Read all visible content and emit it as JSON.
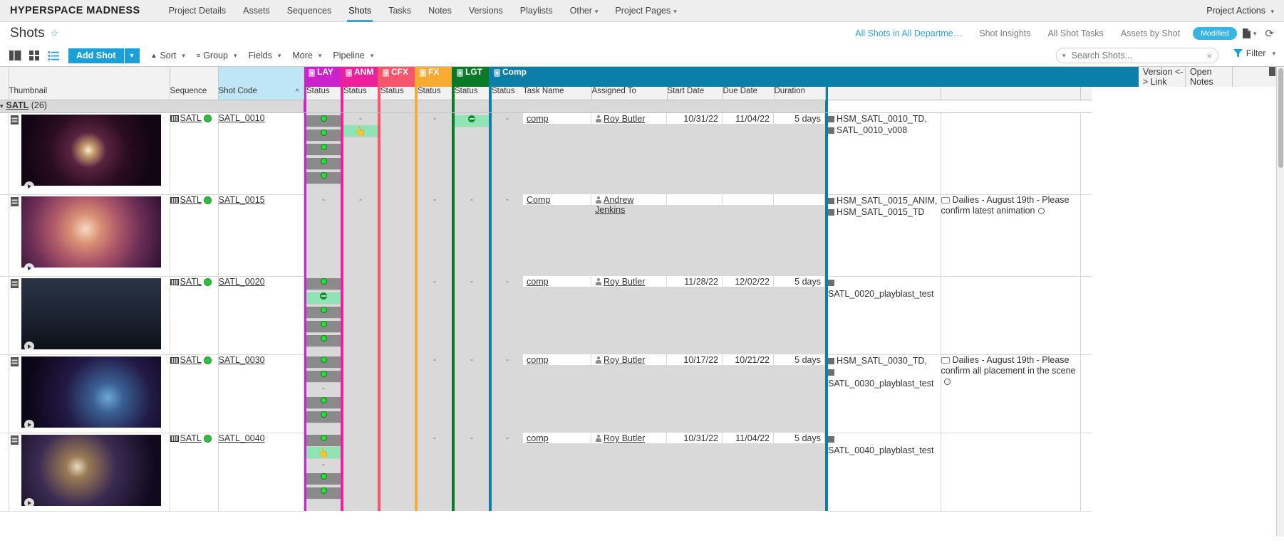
{
  "topnav": {
    "brand": "HYPERSPACE MADNESS",
    "items": [
      {
        "label": "Project Details",
        "active": false,
        "caret": false
      },
      {
        "label": "Assets",
        "active": false,
        "caret": false
      },
      {
        "label": "Sequences",
        "active": false,
        "caret": false
      },
      {
        "label": "Shots",
        "active": true,
        "caret": false
      },
      {
        "label": "Tasks",
        "active": false,
        "caret": false
      },
      {
        "label": "Notes",
        "active": false,
        "caret": false
      },
      {
        "label": "Versions",
        "active": false,
        "caret": false
      },
      {
        "label": "Playlists",
        "active": false,
        "caret": false
      },
      {
        "label": "Other",
        "active": false,
        "caret": true
      },
      {
        "label": "Project Pages",
        "active": false,
        "caret": true
      }
    ],
    "project_actions": "Project Actions"
  },
  "title": {
    "text": "Shots",
    "star": "☆",
    "links": [
      {
        "label": "All Shots in All Departme…",
        "blue": true
      },
      {
        "label": "Shot Insights",
        "blue": false
      },
      {
        "label": "All Shot Tasks",
        "blue": false
      },
      {
        "label": "Assets by Shot",
        "blue": false
      }
    ],
    "badge": "Modified"
  },
  "toolbar": {
    "add_shot": "Add Shot",
    "items": [
      {
        "label": "Sort",
        "icon": "sort-icon"
      },
      {
        "label": "Group",
        "icon": "group-icon"
      },
      {
        "label": "Fields",
        "icon": "fields-icon"
      },
      {
        "label": "More",
        "icon": "more-icon"
      },
      {
        "label": "Pipeline",
        "icon": "pipeline-icon"
      }
    ],
    "filter": "Filter"
  },
  "search": {
    "placeholder": "Search Shots...",
    "value": ""
  },
  "colors": {
    "lay": "#cc22cc",
    "anm": "#ee1f9a",
    "cfx": "#f8546b",
    "fx": "#f7ab33",
    "lgt": "#0a7a28",
    "comp": "#0c7fa8",
    "accent": "#1b9fd8",
    "shotcode_hdr": "#bfe6f5"
  },
  "columns": {
    "thumbnail": "Thumbnail",
    "sequence": "Sequence",
    "shot_code": "Shot Code",
    "pipeline": [
      {
        "key": "lay",
        "label": "LAY",
        "chev": "»"
      },
      {
        "key": "anm",
        "label": "ANM",
        "chev": "»"
      },
      {
        "key": "cfx",
        "label": "CFX",
        "chev": "»"
      },
      {
        "key": "fx",
        "label": "FX",
        "chev": "»"
      },
      {
        "key": "lgt",
        "label": "LGT",
        "chev": "»"
      },
      {
        "key": "comp",
        "label": "Comp",
        "chev": "«"
      }
    ],
    "status": "Status",
    "task_name": "Task Name",
    "assigned_to": "Assigned To",
    "start_date": "Start Date",
    "due_date": "Due Date",
    "duration": "Duration",
    "version_link": "Version <-> Link",
    "open_notes": "Open Notes"
  },
  "group": {
    "name": "SATL",
    "count": "(26)"
  },
  "rows": [
    {
      "sequence": "SATL",
      "shot_code": "SATL_0010",
      "lay": [
        "dot",
        "dot",
        "dot",
        "dot",
        "dot"
      ],
      "anm": [
        "dash",
        "hl-hand"
      ],
      "cfx": [],
      "fx": [
        "dash"
      ],
      "lgt": [
        "ring"
      ],
      "comp_status": "-",
      "task_name": "comp",
      "assigned_to": "Roy Butler",
      "start_date": "10/31/22",
      "due_date": "11/04/22",
      "duration": "5 days",
      "versions": [
        "HSM_SATL_0010_TD,",
        "SATL_0010_v008"
      ],
      "note": ""
    },
    {
      "sequence": "SATL",
      "shot_code": "SATL_0015",
      "lay": [
        "dash"
      ],
      "anm": [
        "dash"
      ],
      "cfx": [],
      "fx": [
        "dash"
      ],
      "lgt": [
        "dash"
      ],
      "comp_status": "-",
      "task_name": "Comp",
      "assigned_to": "Andrew Jenkins",
      "start_date": "",
      "due_date": "",
      "duration": "",
      "versions": [
        "HSM_SATL_0015_ANIM,",
        "HSM_SATL_0015_TD"
      ],
      "note": "Dailies - August 19th - Please confirm latest animation"
    },
    {
      "sequence": "SATL",
      "shot_code": "SATL_0020",
      "lay": [
        "dot",
        "ring",
        "dot",
        "dot",
        "dot"
      ],
      "anm": [],
      "cfx": [],
      "fx": [
        "dash"
      ],
      "lgt": [
        "dash"
      ],
      "comp_status": "-",
      "task_name": "comp",
      "assigned_to": "Roy Butler",
      "start_date": "11/28/22",
      "due_date": "12/02/22",
      "duration": "5 days",
      "versions": [
        "SATL_0020_playblast_test"
      ],
      "note": ""
    },
    {
      "sequence": "SATL",
      "shot_code": "SATL_0030",
      "lay": [
        "dot",
        "dot",
        "dash",
        "dot",
        "dot"
      ],
      "anm": [],
      "cfx": [],
      "fx": [
        "dash"
      ],
      "lgt": [
        "dash"
      ],
      "comp_status": "-",
      "task_name": "comp",
      "assigned_to": "Roy Butler",
      "start_date": "10/17/22",
      "due_date": "10/21/22",
      "duration": "5 days",
      "versions": [
        "HSM_SATL_0030_TD,",
        "SATL_0030_playblast_test"
      ],
      "note": "Dailies - August 19th - Please confirm all placement in the scene"
    },
    {
      "sequence": "SATL",
      "shot_code": "SATL_0040",
      "lay": [
        "dot",
        "hl-hand",
        "dash",
        "dot",
        "dot"
      ],
      "anm": [],
      "cfx": [],
      "fx": [
        "dash"
      ],
      "lgt": [
        "dash"
      ],
      "comp_status": "-",
      "task_name": "comp",
      "assigned_to": "Roy Butler",
      "start_date": "10/31/22",
      "due_date": "11/04/22",
      "duration": "5 days",
      "versions": [
        "SATL_0040_playblast_test"
      ],
      "note": ""
    }
  ]
}
